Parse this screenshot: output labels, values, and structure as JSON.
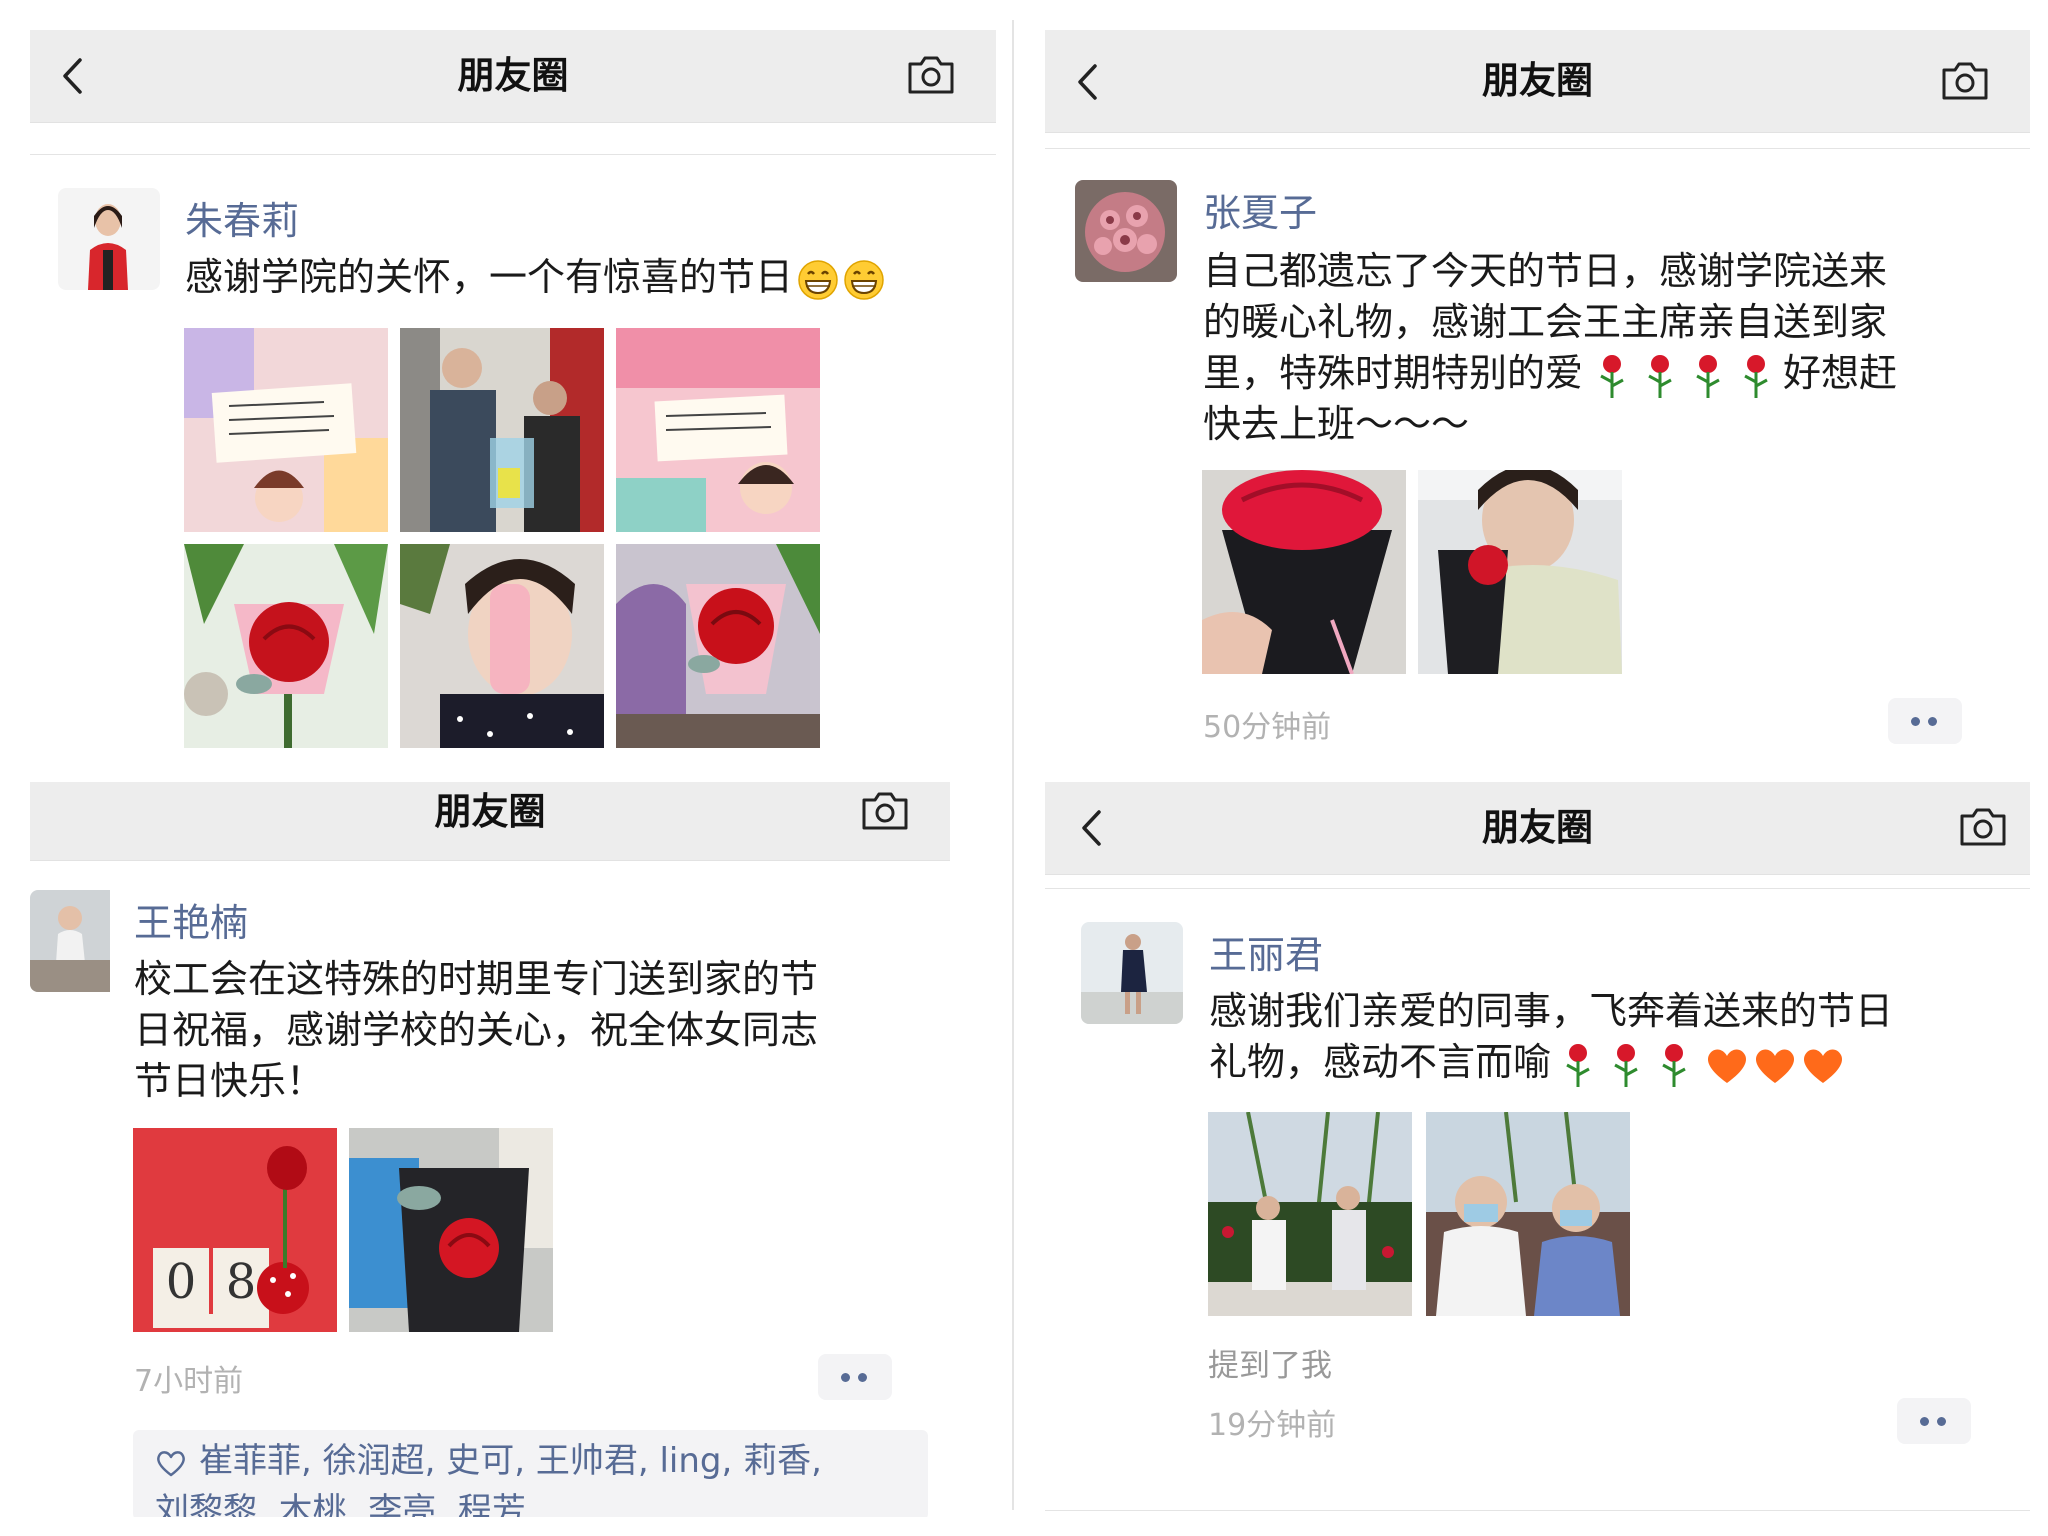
{
  "panels": [
    {
      "header_title": "朋友圈",
      "user_name": "朱春莉",
      "post_text": "感谢学院的关怀，一个有惊喜的节日",
      "emoji_count": 2
    },
    {
      "header_title": "朋友圈",
      "user_name": "张夏子",
      "post_lines": [
        "自己都遗忘了今天的节日，感谢学院送来",
        "的暖心礼物，感谢工会王主席亲自送到家",
        "里，特殊时期特别的爱",
        "快去上班～～～"
      ],
      "post_line3_tail": "好想赶",
      "time": "50分钟前"
    },
    {
      "header_title": "朋友圈",
      "user_name": "王艳楠",
      "post_lines": [
        "校工会在这特殊的时期里专门送到家的节",
        "日祝福，感谢学校的关心，祝全体女同志",
        "节日快乐！"
      ],
      "time": "7小时前",
      "likes_line1": "崔菲菲, 徐润超, 史可, 王帅君, ling, 莉香,",
      "likes_line2": "刘黎黎, 木桃, 李亮, 程芳"
    },
    {
      "header_title": "朋友圈",
      "user_name": "王丽君",
      "post_lines": [
        "感谢我们亲爱的同事，飞奔着送来的节日",
        "礼物，感动不言而喻"
      ],
      "mention": "提到了我",
      "time": "19分钟前"
    }
  ],
  "icons": {
    "back": "chevron-left-icon",
    "camera": "camera-icon",
    "more": "more-dots-icon",
    "like": "heart-outline-icon",
    "rose": "rose-emoji",
    "heart": "orange-heart-emoji",
    "grin": "grinning-emoji"
  },
  "colors": {
    "link": "#576b95",
    "header_bg": "#ededed",
    "muted": "#b2b2b2"
  }
}
